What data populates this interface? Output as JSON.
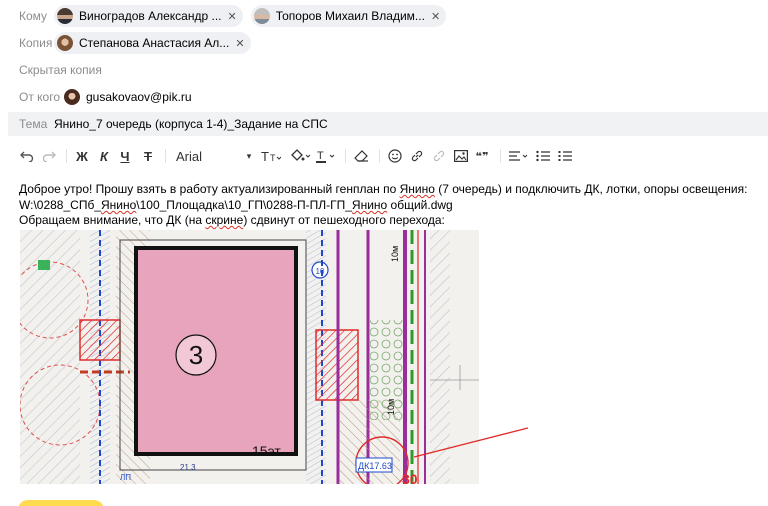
{
  "header": {
    "to": {
      "label": "Кому",
      "recipients": [
        {
          "name": "Виноградов Александр ..."
        },
        {
          "name": "Топоров Михаил Владим..."
        }
      ]
    },
    "cc": {
      "label": "Копия",
      "recipients": [
        {
          "name": "Степанова Анастасия Ал..."
        }
      ]
    },
    "bcc": {
      "label": "Скрытая копия"
    },
    "from": {
      "label": "От кого",
      "email": "gusakovaov@pik.ru"
    },
    "subject": {
      "label": "Тема",
      "value": "Янино_7 очередь (корпуса 1-4)_Задание на СПС"
    }
  },
  "toolbar": {
    "font_name": "Arial",
    "bold_glyph": "Ж",
    "italic_glyph": "К",
    "underline_glyph": "Ч",
    "strike_glyph": "Т",
    "quote_glyph": "❝❞",
    "icons": [
      "undo-icon",
      "redo-icon",
      "bold-icon",
      "italic-icon",
      "underline-icon",
      "strikethrough-icon",
      "font-size-icon",
      "fill-color-icon",
      "text-color-icon",
      "clear-format-icon",
      "emoji-icon",
      "link-icon",
      "unlink-icon",
      "image-icon",
      "quote-icon",
      "align-icon",
      "bullet-list-icon",
      "numbered-list-icon"
    ]
  },
  "body": {
    "line1_a": "Доброе утро! Прошу взять в работу актуализированный генплан по ",
    "line1_b": "Янино",
    "line1_c": " (7 очередь) и подключить ДК, лотки, опоры освещения:",
    "line2_a": "W:\\0288_СПб_",
    "line2_b": "Янино",
    "line2_c": "\\100_Площадка\\10_ГП\\0288-П-ПЛ-ГП_",
    "line2_d": "Янино",
    "line2_e": " общий.dwg",
    "line3_a": " Обращаем внимание, что ДК (на ",
    "line3_b": "скрине",
    "line3_c": ") сдвинут от пешеходного перехода:"
  },
  "plan": {
    "building_number": "3",
    "floors_label": "15эт",
    "dk_label": "ДК17.63",
    "road_label_1": "10м",
    "road_label_2": "10м",
    "small_label_1": "10",
    "small_label_2": "21.3",
    "small_label_3": "ЛП",
    "corner_label": "30"
  },
  "colors": {
    "accent_yellow": "#ffdb4d",
    "building_fill": "#e8a4bc",
    "red_annotation": "#e02a2a",
    "purple_line": "#9b2c9c",
    "green_line": "#2e9a2e"
  }
}
